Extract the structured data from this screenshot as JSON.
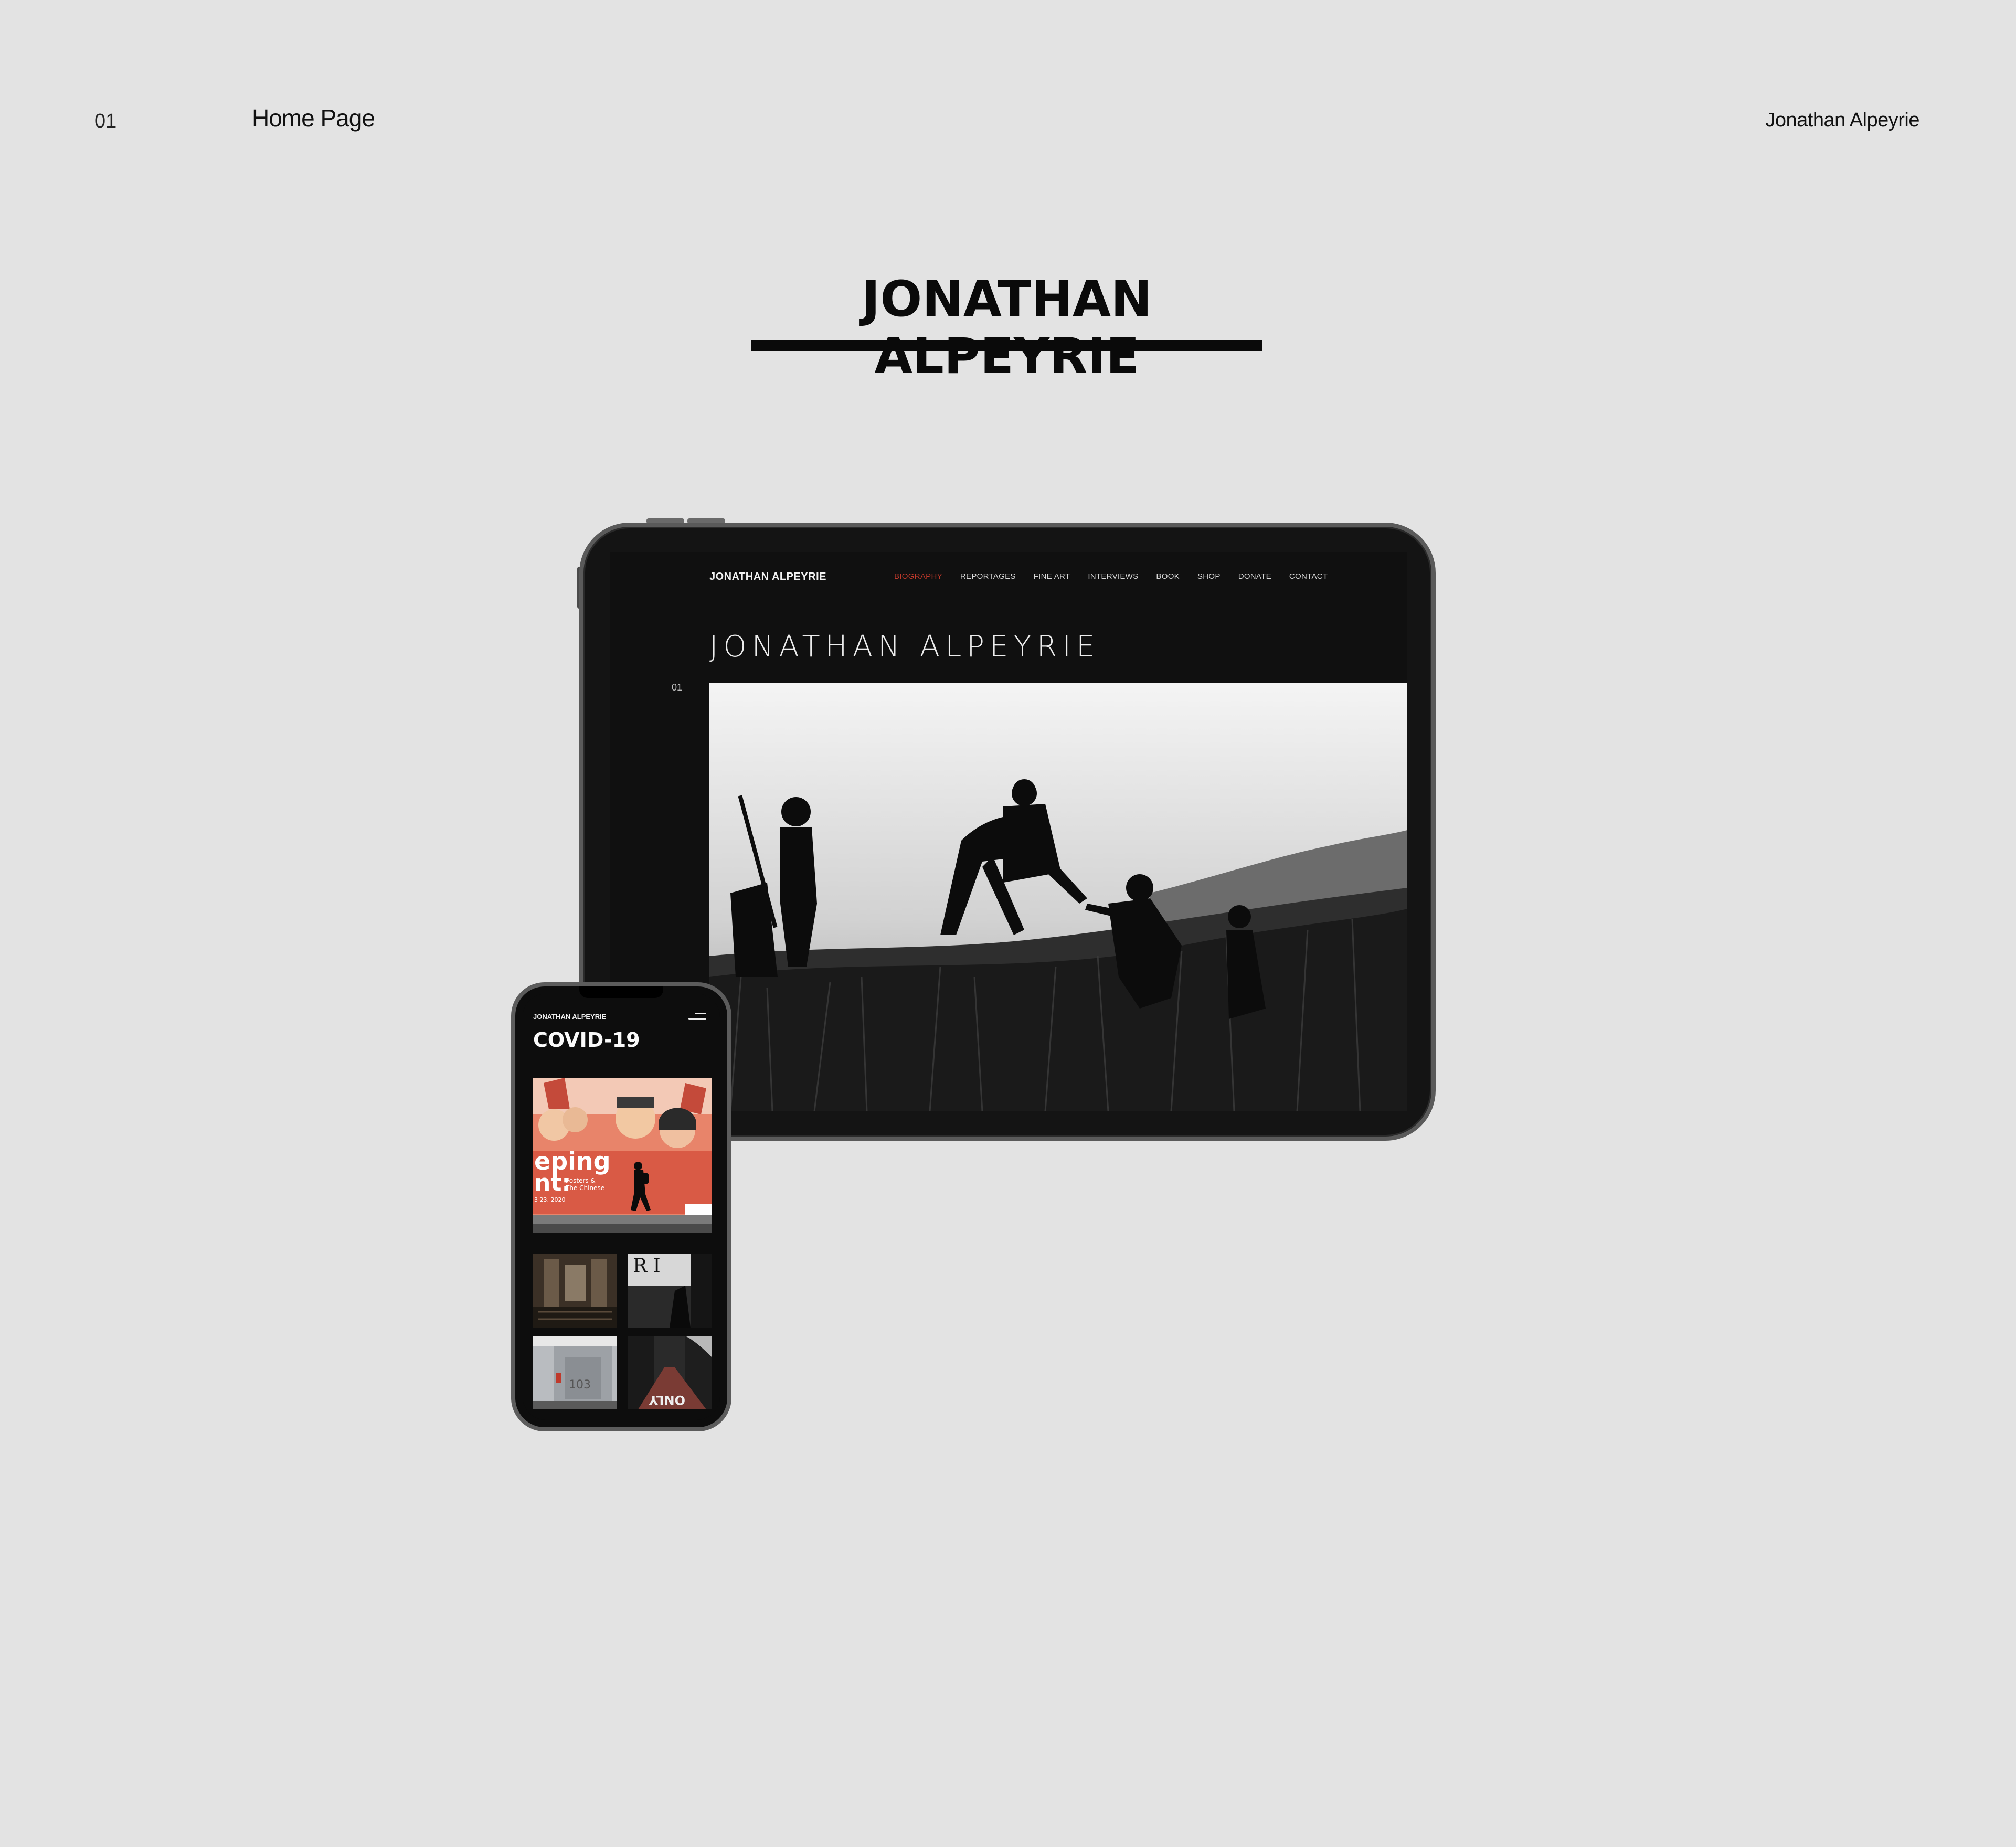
{
  "header": {
    "number": "01",
    "page_label": "Home Page",
    "author": "Jonathan Alpeyrie"
  },
  "title": "JONATHAN ALPEYRIE",
  "tablet": {
    "brand": "JONATHAN ALPEYRIE",
    "nav": [
      {
        "label": "BIOGRAPHY",
        "active": true
      },
      {
        "label": "REPORTAGES",
        "active": false
      },
      {
        "label": "FINE ART",
        "active": false
      },
      {
        "label": "INTERVIEWS",
        "active": false
      },
      {
        "label": "BOOK",
        "active": false
      },
      {
        "label": "SHOP",
        "active": false
      },
      {
        "label": "DONATE",
        "active": false
      },
      {
        "label": "CONTACT",
        "active": false
      }
    ],
    "hero_title": "JONATHAN  ALPEYRIE",
    "slide_index": "01"
  },
  "phone": {
    "brand": "JONATHAN ALPEYRIE",
    "title": "COVID-19",
    "feature_text": {
      "big1": "eping",
      "big2": "nt:",
      "small1": "Posters &",
      "small2": "The Chinese",
      "date": "3 23, 2020"
    },
    "thumb_text": {
      "sign": "R I",
      "number": "103",
      "street": "ONLY"
    }
  },
  "colors": {
    "background": "#e3e3e3",
    "nav_active": "#c0392b"
  },
  "icons": {
    "menu": "hamburger-menu-icon"
  }
}
